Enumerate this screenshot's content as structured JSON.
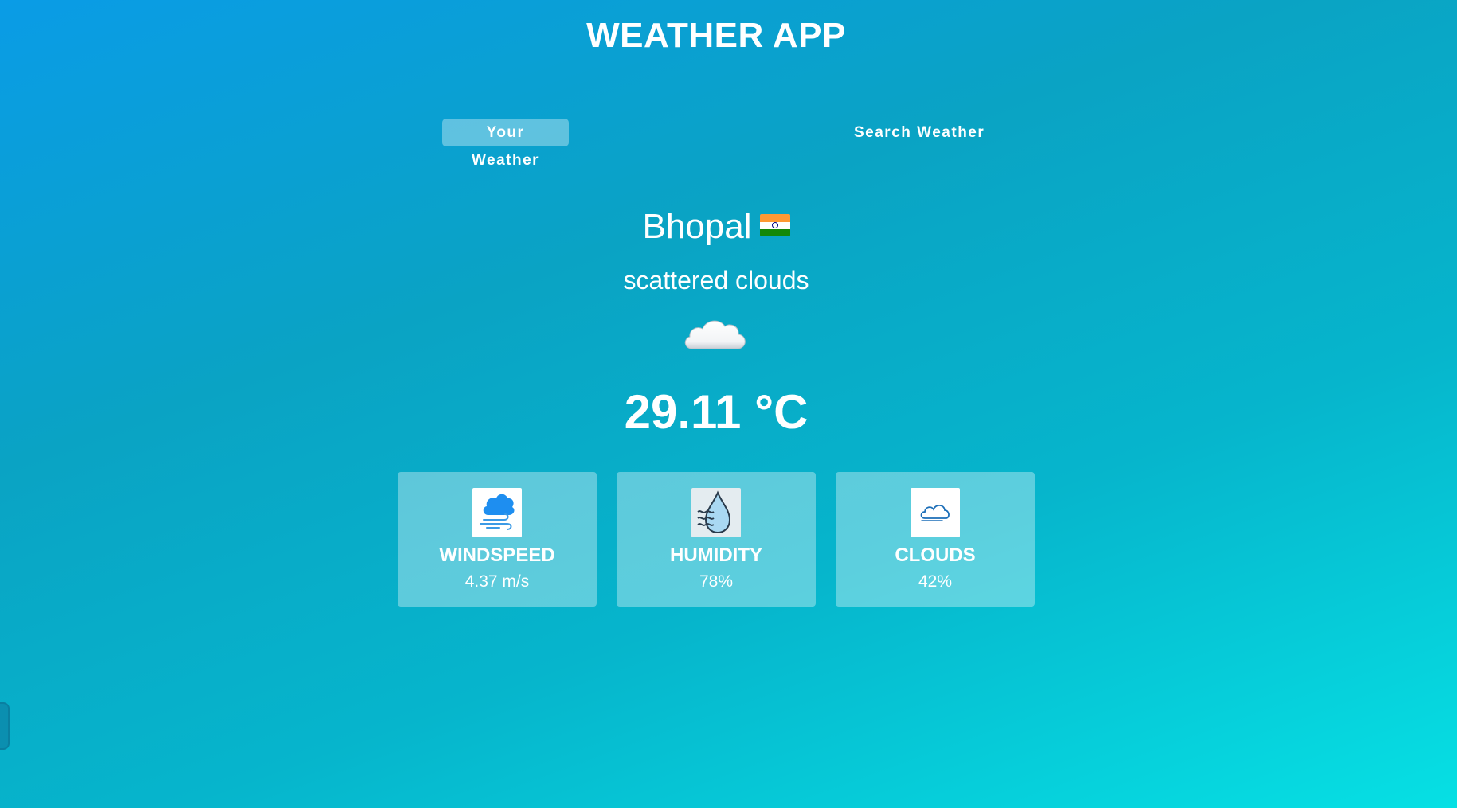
{
  "app": {
    "title": "WEATHER APP"
  },
  "tabs": [
    {
      "label": "Your Weather",
      "active": true
    },
    {
      "label": "Search Weather",
      "active": false
    }
  ],
  "weather": {
    "city": "Bhopal",
    "country_flag_icon": "india-flag-icon",
    "description": "scattered clouds",
    "condition_icon": "cloud-icon",
    "temperature": "29.11 °C"
  },
  "stats": [
    {
      "label": "WINDSPEED",
      "value": "4.37 m/s",
      "icon": "windspeed-icon"
    },
    {
      "label": "HUMIDITY",
      "value": "78%",
      "icon": "humidity-icon"
    },
    {
      "label": "CLOUDS",
      "value": "42%",
      "icon": "clouds-icon"
    }
  ],
  "colors": {
    "gradient_start": "#0a9ce6",
    "gradient_end": "#06e0e4",
    "text": "#ffffff",
    "card_background": "rgba(255,255,255,0.35)"
  }
}
